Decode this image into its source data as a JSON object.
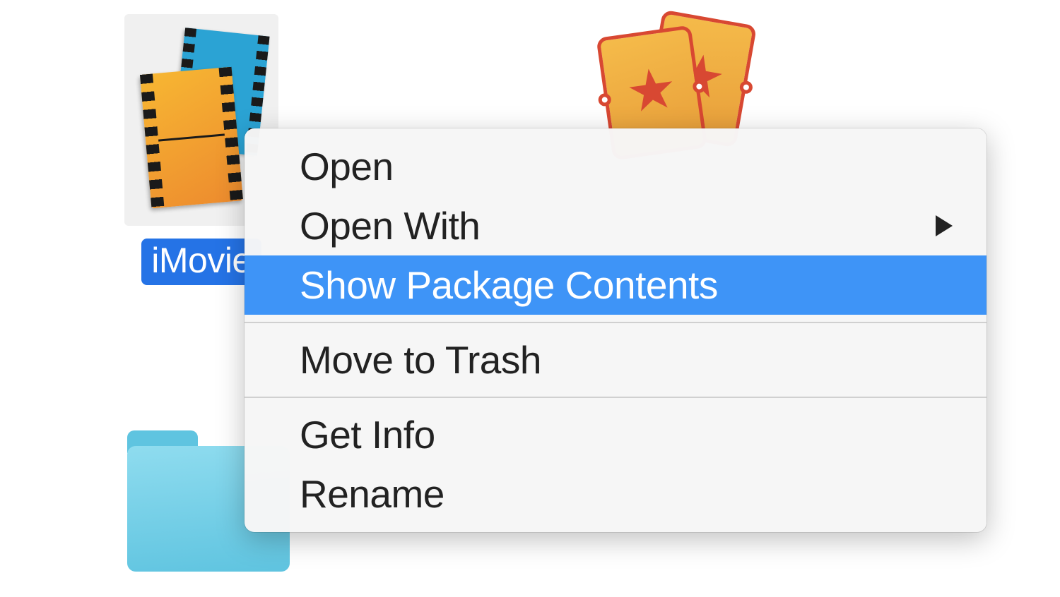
{
  "file": {
    "name": "iMovie"
  },
  "context_menu": {
    "items": [
      {
        "label": "Open",
        "type": "item"
      },
      {
        "label": "Open With",
        "type": "submenu"
      },
      {
        "label": "Show Package Contents",
        "type": "item",
        "highlighted": true
      },
      {
        "type": "separator"
      },
      {
        "label": "Move to Trash",
        "type": "item"
      },
      {
        "type": "separator"
      },
      {
        "label": "Get Info",
        "type": "item"
      },
      {
        "label": "Rename",
        "type": "item"
      }
    ]
  }
}
